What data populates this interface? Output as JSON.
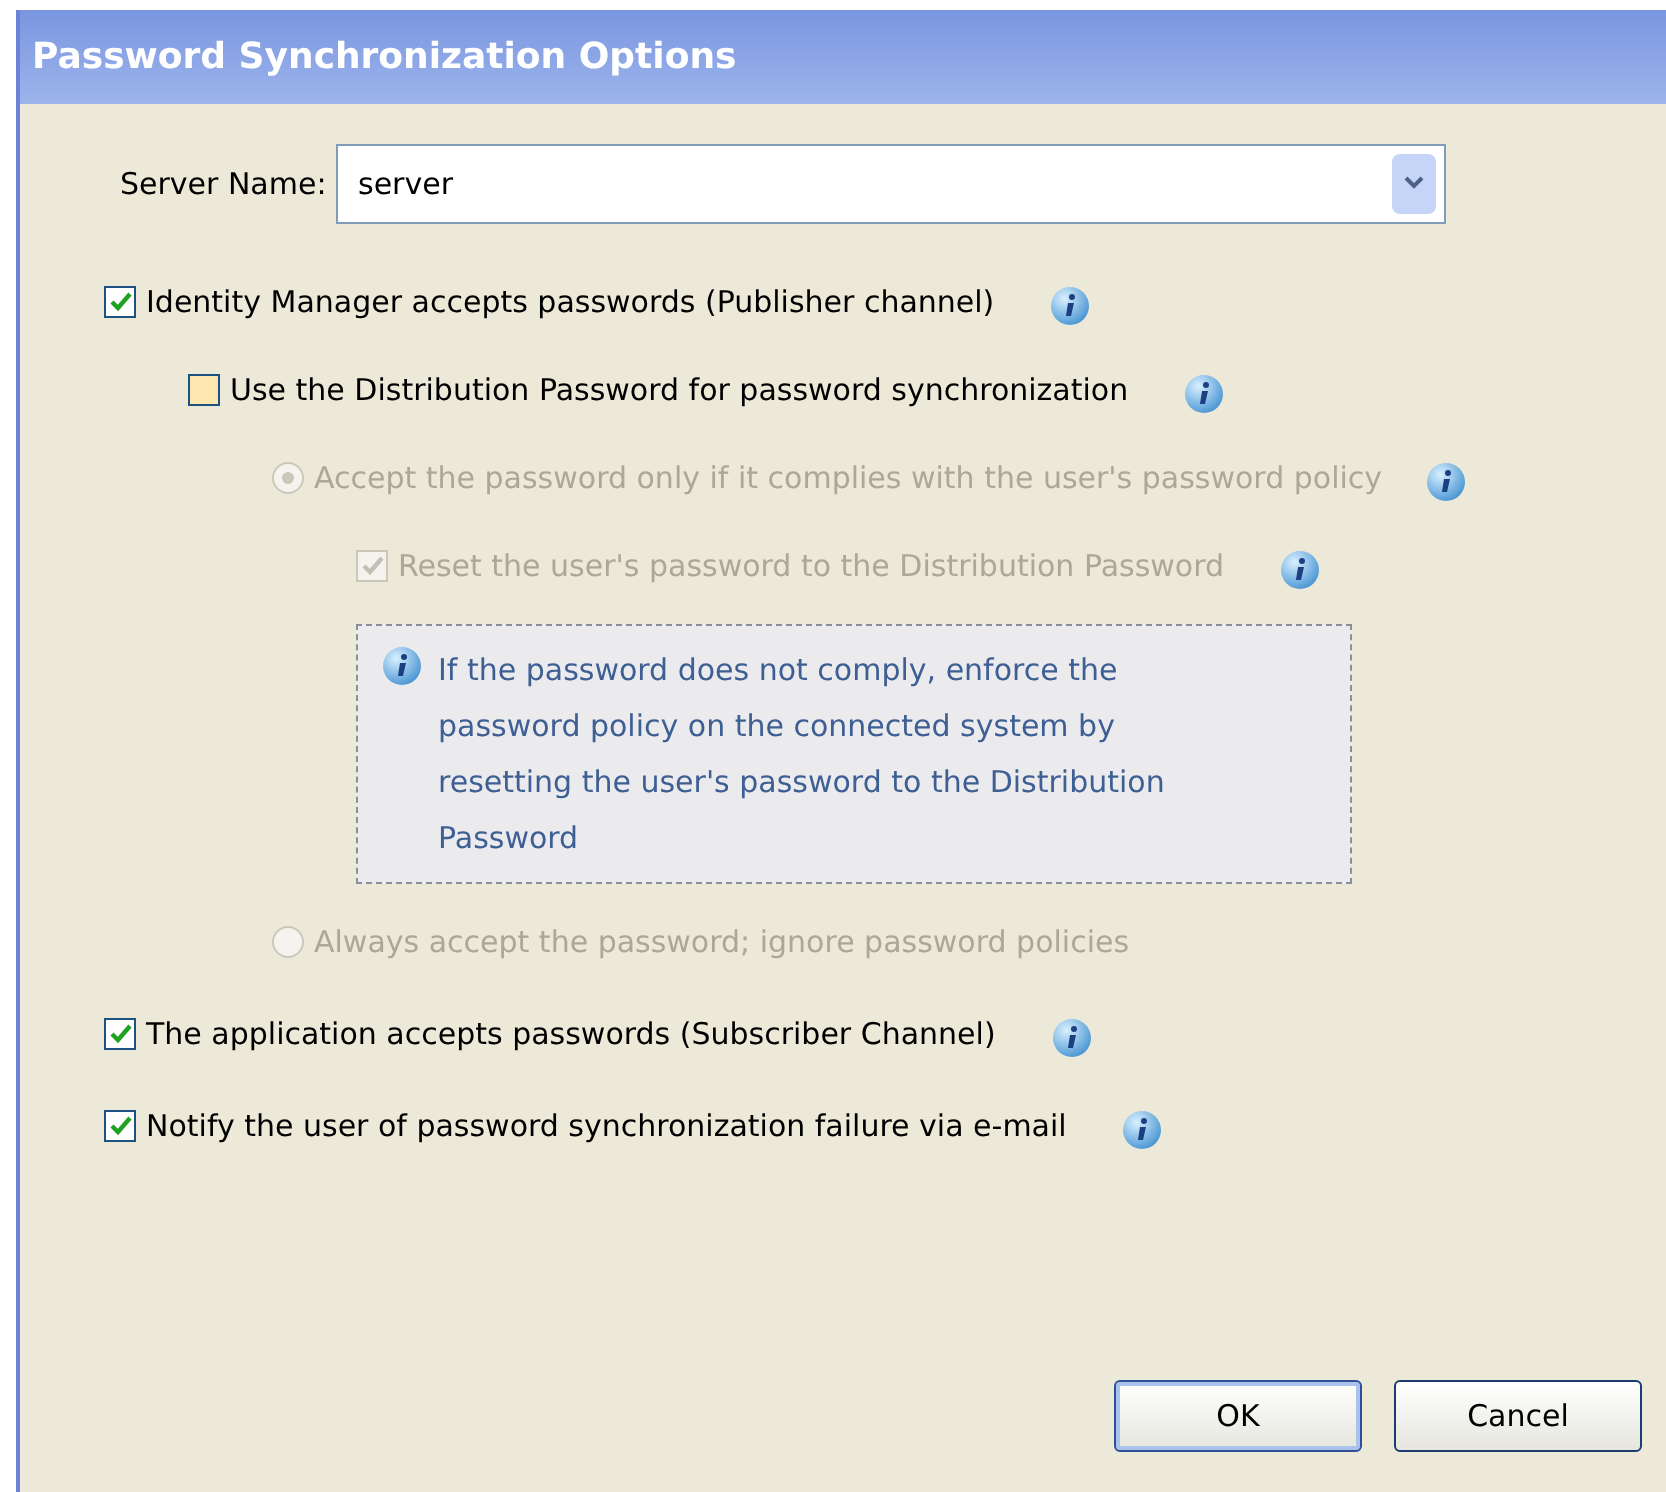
{
  "window": {
    "title": "Password Synchronization Options"
  },
  "server": {
    "label": "Server Name:",
    "value": "server"
  },
  "options": [
    {
      "kind": "checkbox",
      "label": "Identity Manager accepts passwords (Publisher channel)",
      "checked": true,
      "disabled": false,
      "children": [
        {
          "kind": "checkbox",
          "label": "Use the Distribution Password for password synchronization",
          "checked": false,
          "disabled": false,
          "children": [
            {
              "kind": "radio",
              "label": "Accept the password only if it complies with the user's password policy",
              "selected": true,
              "disabled": true,
              "children": [
                {
                  "kind": "checkbox",
                  "label": "Reset the user's password to the Distribution Password",
                  "checked": true,
                  "disabled": true
                },
                {
                  "kind": "note",
                  "text": "If the password does not comply, enforce the password policy on the connected system by resetting the user's password to the Distribution Password"
                }
              ]
            },
            {
              "kind": "radio",
              "label": "Always accept the password; ignore password policies",
              "selected": false,
              "disabled": true
            }
          ]
        }
      ]
    },
    {
      "kind": "checkbox",
      "label": "The application accepts passwords (Subscriber Channel)",
      "checked": true,
      "disabled": false
    },
    {
      "kind": "checkbox",
      "label": "Notify the user of password synchronization failure via e-mail",
      "checked": true,
      "disabled": false
    }
  ],
  "buttons": [
    {
      "label": "OK",
      "default": true
    },
    {
      "label": "Cancel",
      "default": false
    }
  ]
}
